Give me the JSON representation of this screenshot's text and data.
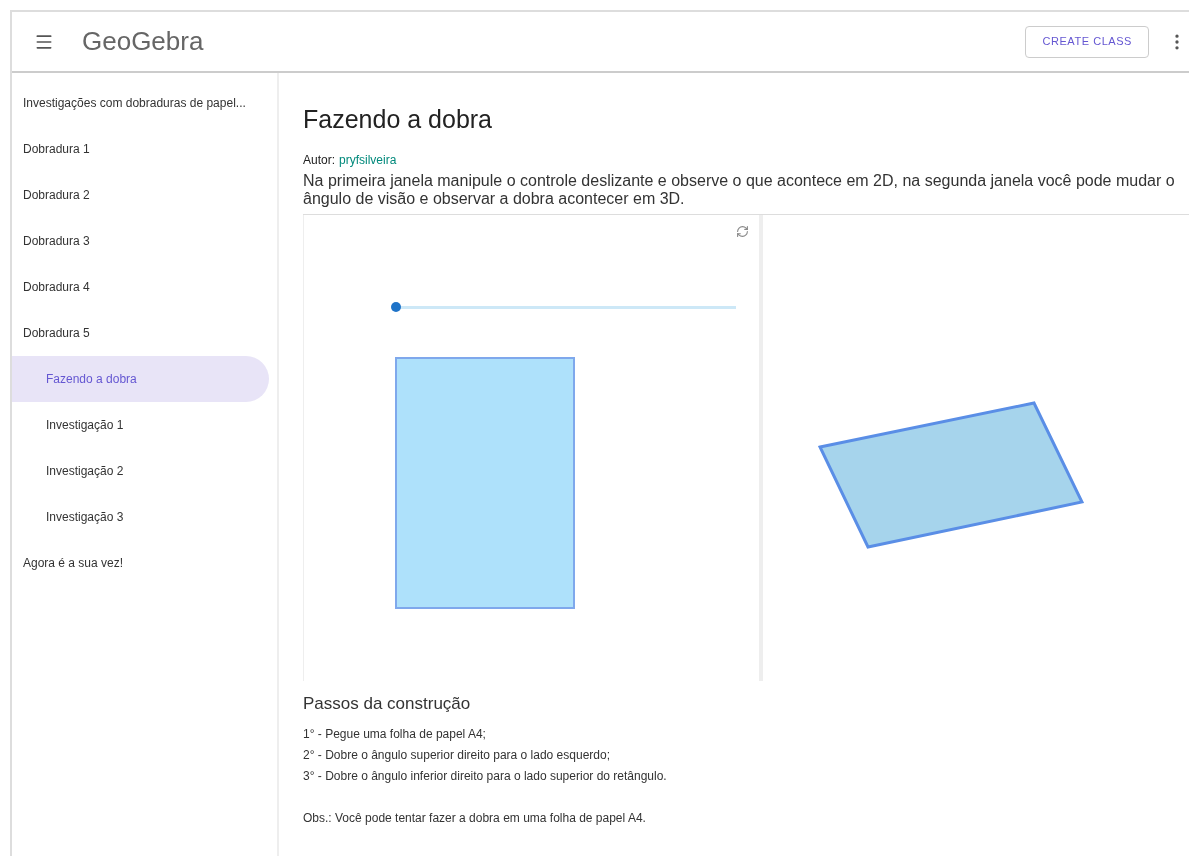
{
  "header": {
    "logo": "GeoGebra",
    "create_button": "CREATE CLASS"
  },
  "sidebar": {
    "items": [
      {
        "label": "Investigações com dobraduras de papel...",
        "selected": false
      },
      {
        "label": "Dobradura 1",
        "selected": false
      },
      {
        "label": "Dobradura 2",
        "selected": false
      },
      {
        "label": "Dobradura 3",
        "selected": false
      },
      {
        "label": "Dobradura 4",
        "selected": false
      },
      {
        "label": "Dobradura 5",
        "selected": false,
        "children": [
          {
            "label": "Fazendo a dobra",
            "selected": true
          },
          {
            "label": "Investigação 1",
            "selected": false
          },
          {
            "label": "Investigação 2",
            "selected": false
          },
          {
            "label": "Investigação 3",
            "selected": false
          }
        ]
      },
      {
        "label": "Agora é a sua vez!",
        "selected": false
      }
    ]
  },
  "main": {
    "title": "Fazendo a dobra",
    "author_label": "Autor:",
    "author": "pryfsilveira",
    "description": "Na primeira janela manipule o controle deslizante e observe o que acontece em 2D, na segunda janela você pode mudar o ângulo de visão e observar a dobra acontecer em 3D.",
    "applet": {
      "slider": {
        "level": 0
      }
    },
    "steps_title": "Passos da construção",
    "steps": [
      "1° - Pegue uma folha de papel A4;",
      "2° - Dobre o ângulo superior direito para o lado esquerdo;",
      "3° - Dobre o ângulo inferior direito para o lado superior do retângulo."
    ],
    "note": "Obs.: Você pode tentar fazer a dobra em uma folha de papel A4."
  }
}
